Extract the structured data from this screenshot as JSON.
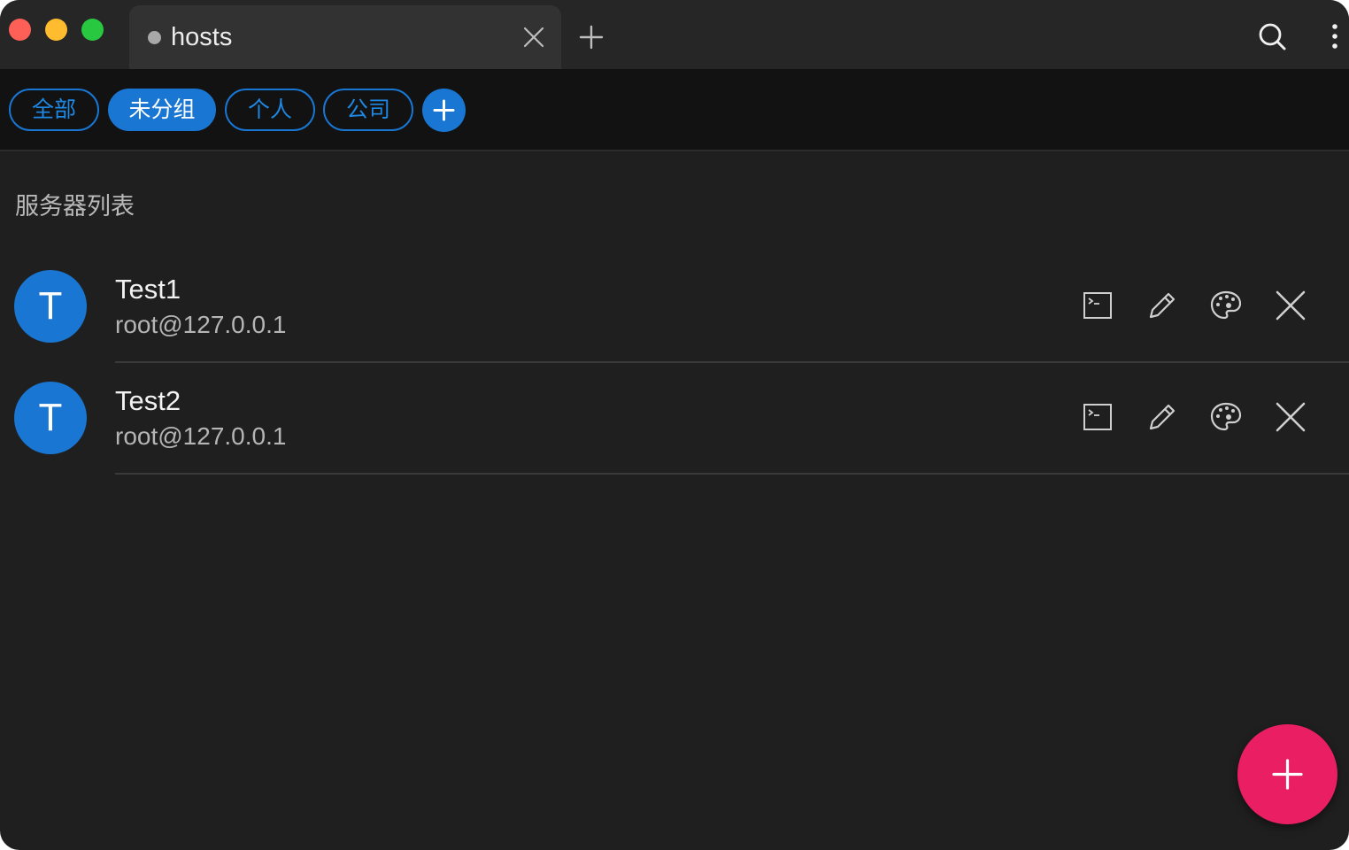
{
  "window": {
    "traffic_lights": [
      "close",
      "minimize",
      "maximize"
    ]
  },
  "tabs": [
    {
      "title": "hosts",
      "icon": "status-dot-icon",
      "close_icon": "close-icon"
    }
  ],
  "toolbar": {
    "new_tab_icon": "plus-icon",
    "search_icon": "search-icon",
    "menu_icon": "more-vertical-icon"
  },
  "groups": {
    "items": [
      {
        "label": "全部",
        "active": false
      },
      {
        "label": "未分组",
        "active": true
      },
      {
        "label": "个人",
        "active": false
      },
      {
        "label": "公司",
        "active": false
      }
    ],
    "add_icon": "plus-icon"
  },
  "server_list": {
    "title": "服务器列表",
    "hosts": [
      {
        "avatar": "T",
        "name": "Test1",
        "address": "root@127.0.0.1"
      },
      {
        "avatar": "T",
        "name": "Test2",
        "address": "root@127.0.0.1"
      }
    ],
    "actions": [
      "terminal-icon",
      "edit-pencil-icon",
      "palette-icon",
      "delete-icon"
    ]
  },
  "fab": {
    "icon": "plus-icon"
  },
  "colors": {
    "background": "#1f1f1f",
    "titlebar": "#262626",
    "groupbar": "#121212",
    "accent": "#1976d2",
    "fab": "#e91e63"
  }
}
